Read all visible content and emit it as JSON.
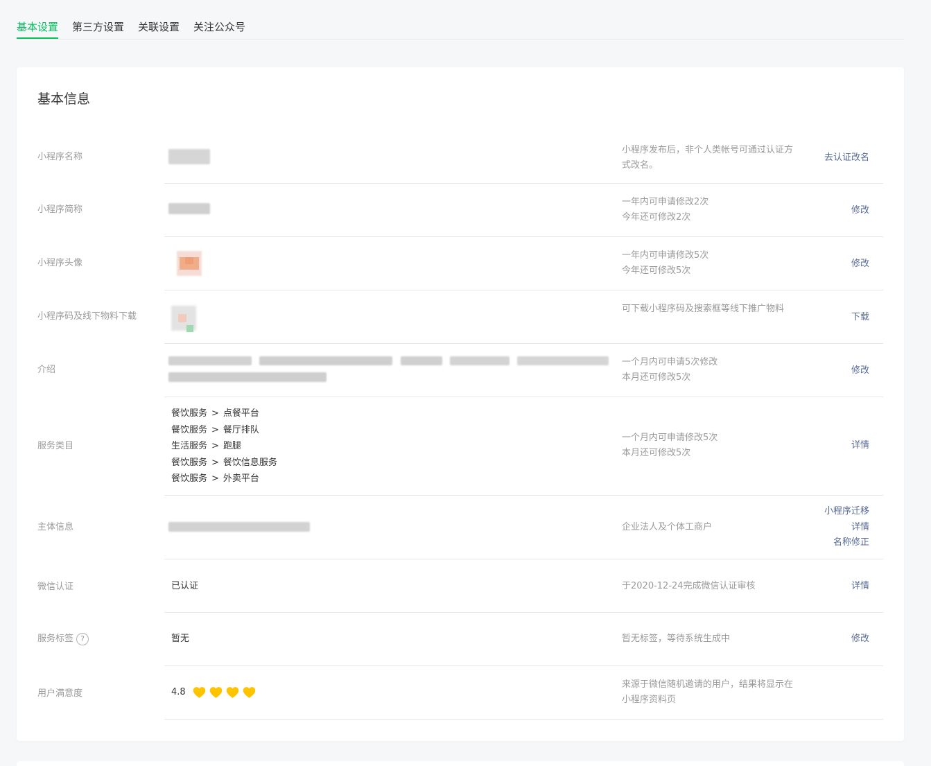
{
  "tabs": [
    {
      "label": "基本设置",
      "active": true
    },
    {
      "label": "第三方设置",
      "active": false
    },
    {
      "label": "关联设置",
      "active": false
    },
    {
      "label": "关注公众号",
      "active": false
    }
  ],
  "card": {
    "title": "基本信息"
  },
  "rows": {
    "name": {
      "label": "小程序名称",
      "tip": "小程序发布后，非个人类帐号可通过认证方式改名。",
      "actions": [
        "去认证改名"
      ]
    },
    "short_name": {
      "label": "小程序简称",
      "tip_lines": [
        "一年内可申请修改2次",
        "今年还可修改2次"
      ],
      "actions": [
        "修改"
      ]
    },
    "avatar": {
      "label": "小程序头像",
      "tip_lines": [
        "一年内可申请修改5次",
        "今年还可修改5次"
      ],
      "actions": [
        "修改"
      ]
    },
    "qrcode": {
      "label": "小程序码及线下物料下载",
      "tip": "可下载小程序码及搜索框等线下推广物料",
      "actions": [
        "下载"
      ]
    },
    "intro": {
      "label": "介绍",
      "tip_lines": [
        "一个月内可申请5次修改",
        "本月还可修改5次"
      ],
      "actions": [
        "修改"
      ]
    },
    "category": {
      "label": "服务类目",
      "items": [
        {
          "main": "餐饮服务",
          "sub": "点餐平台"
        },
        {
          "main": "餐饮服务",
          "sub": "餐厅排队"
        },
        {
          "main": "生活服务",
          "sub": "跑腿"
        },
        {
          "main": "餐饮服务",
          "sub": "餐饮信息服务"
        },
        {
          "main": "餐饮服务",
          "sub": "外卖平台"
        }
      ],
      "separator": ">",
      "tip_lines": [
        "一个月内可申请修改5次",
        "本月还可修改5次"
      ],
      "actions": [
        "详情"
      ]
    },
    "subject": {
      "label": "主体信息",
      "tip": "企业法人及个体工商户",
      "actions": [
        "小程序迁移",
        "详情",
        "名称修正"
      ]
    },
    "wechat_auth": {
      "label": "微信认证",
      "value": "已认证",
      "tip": "于2020-12-24完成微信认证审核",
      "actions": [
        "详情"
      ]
    },
    "service_tags": {
      "label": "服务标签",
      "help_icon": "question-circle-icon",
      "help_glyph": "?",
      "value": "暂无",
      "tip": "暂无标签，等待系统生成中",
      "actions": [
        "修改"
      ]
    },
    "satisfaction": {
      "label": "用户满意度",
      "score": "4.8",
      "hearts": 4,
      "heart_color": "#ffc300",
      "tip": "来源于微信随机邀请的用户，结果将显示在小程序资料页"
    }
  },
  "colors": {
    "accent": "#07c160",
    "link": "#576b95",
    "muted": "#9a9a9a"
  }
}
